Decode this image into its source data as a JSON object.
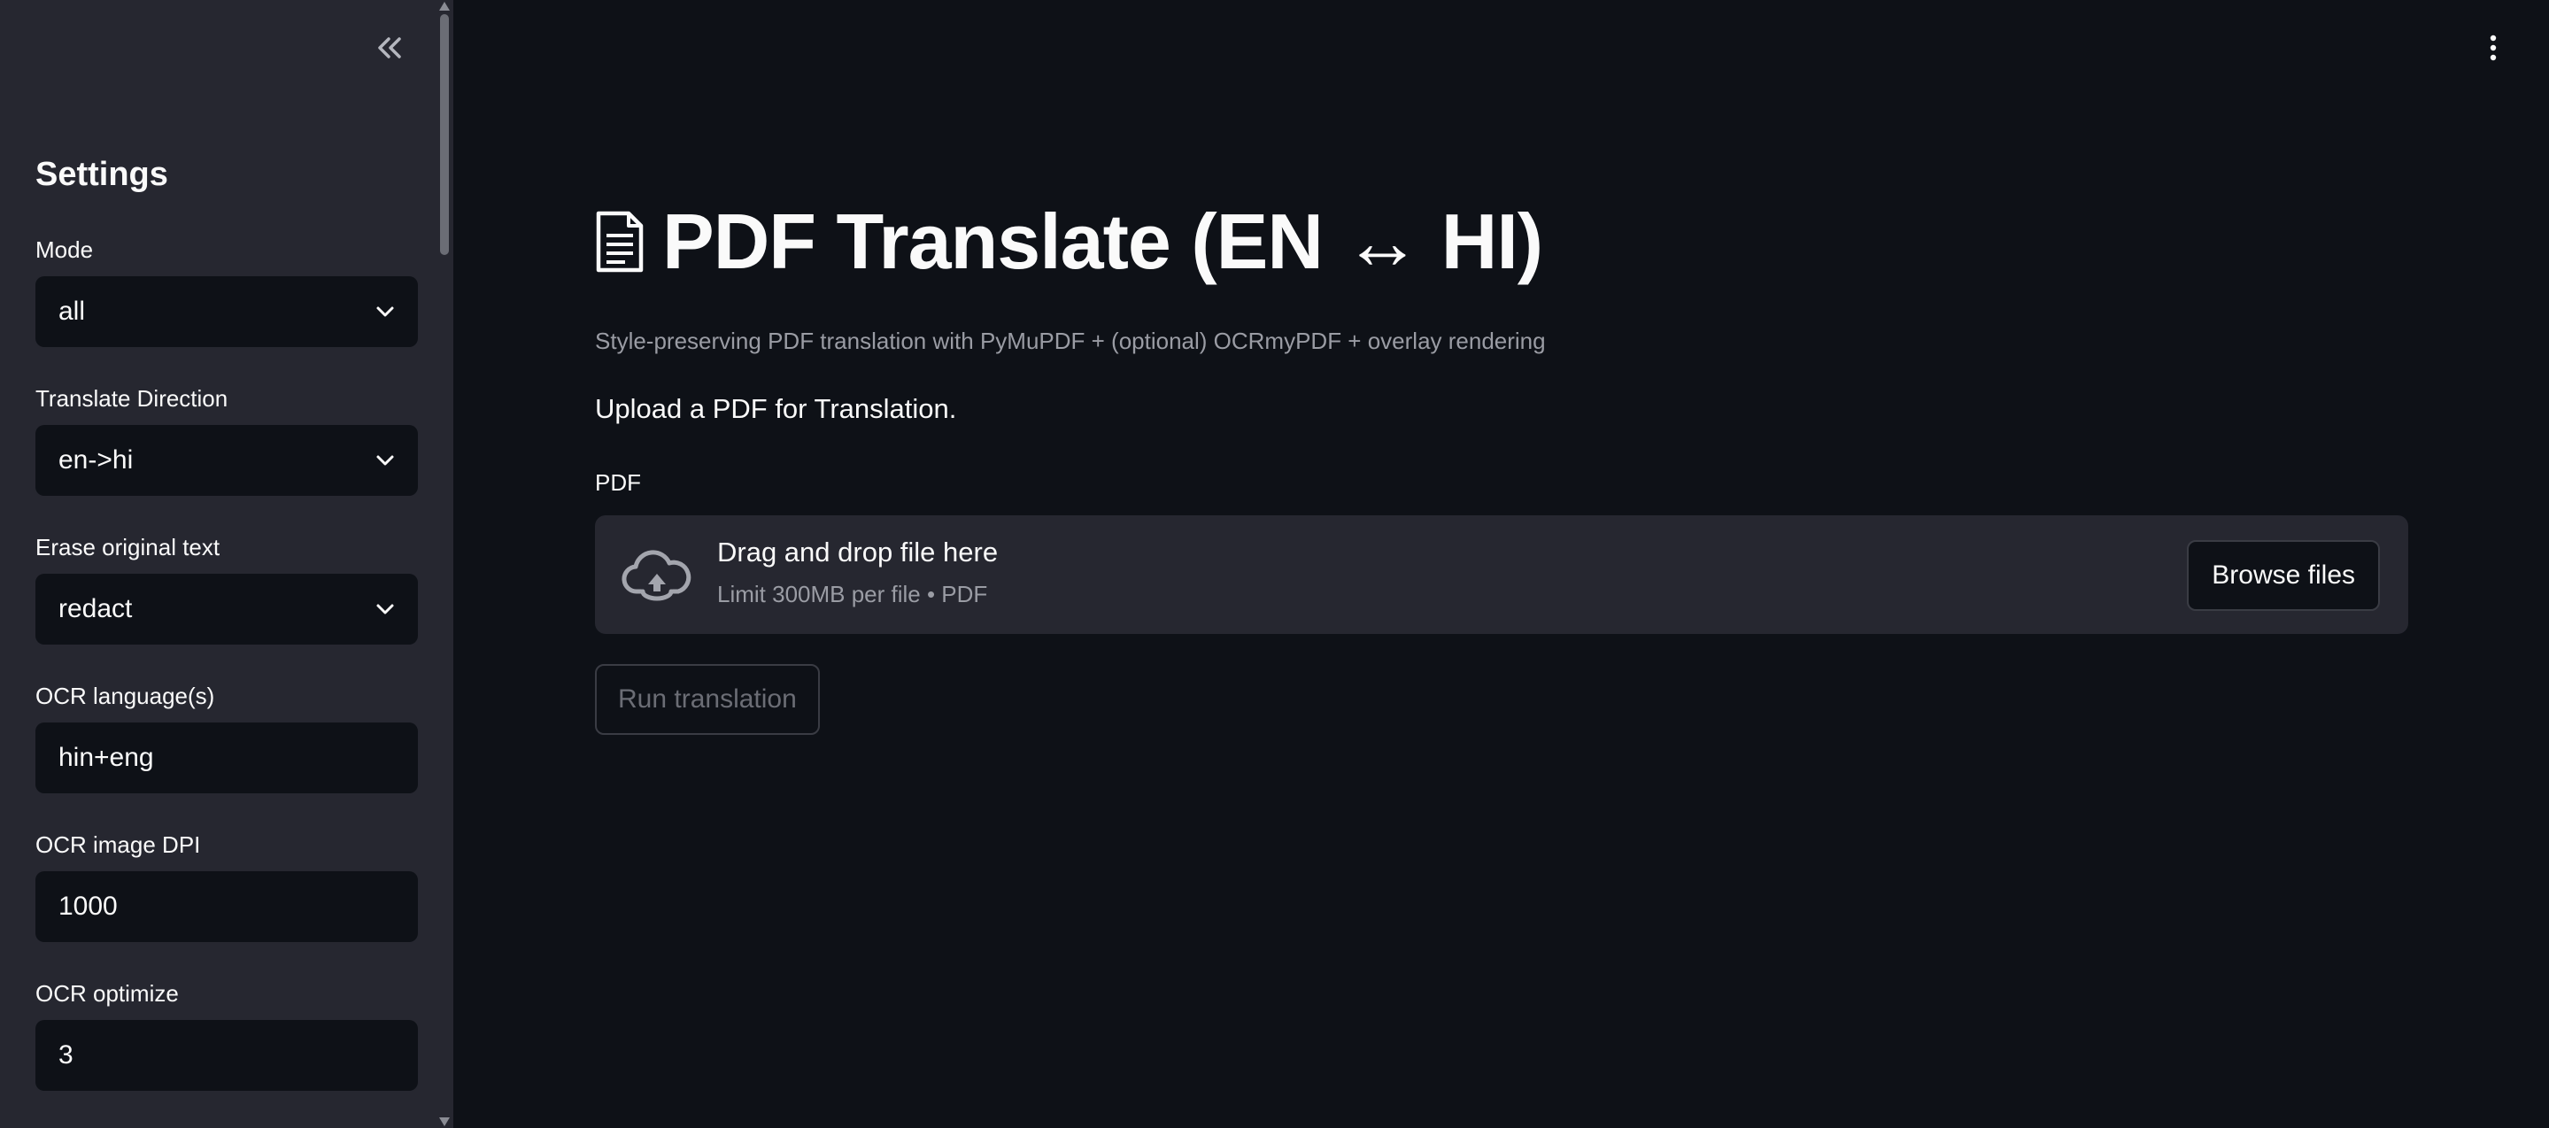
{
  "sidebar": {
    "title": "Settings",
    "fields": [
      {
        "label": "Mode",
        "value": "all",
        "kind": "select"
      },
      {
        "label": "Translate Direction",
        "value": "en->hi",
        "kind": "select"
      },
      {
        "label": "Erase original text",
        "value": "redact",
        "kind": "select"
      },
      {
        "label": "OCR language(s)",
        "value": "hin+eng",
        "kind": "text"
      },
      {
        "label": "OCR image DPI",
        "value": "1000",
        "kind": "text"
      },
      {
        "label": "OCR optimize",
        "value": "3",
        "kind": "text"
      }
    ]
  },
  "main": {
    "title": "PDF Translate (EN ↔ HI)",
    "caption": "Style-preserving PDF translation with PyMuPDF + (optional) OCRmyPDF + overlay rendering",
    "upload_prompt": "Upload a PDF for Translation.",
    "uploader": {
      "label": "PDF",
      "drop_text": "Drag and drop file here",
      "limit_text": "Limit 300MB per file • PDF",
      "browse_label": "Browse files"
    },
    "run_button_label": "Run translation"
  },
  "icons": {
    "collapse": "double-chevron-left-icon",
    "menu": "kebab-menu-icon",
    "title_icon": "document-icon",
    "upload": "cloud-upload-icon",
    "select_arrow": "chevron-down-icon"
  },
  "colors": {
    "background": "#0e1117",
    "sidebar": "#262730",
    "text": "#fafafa",
    "muted": "#9a9ca4"
  }
}
